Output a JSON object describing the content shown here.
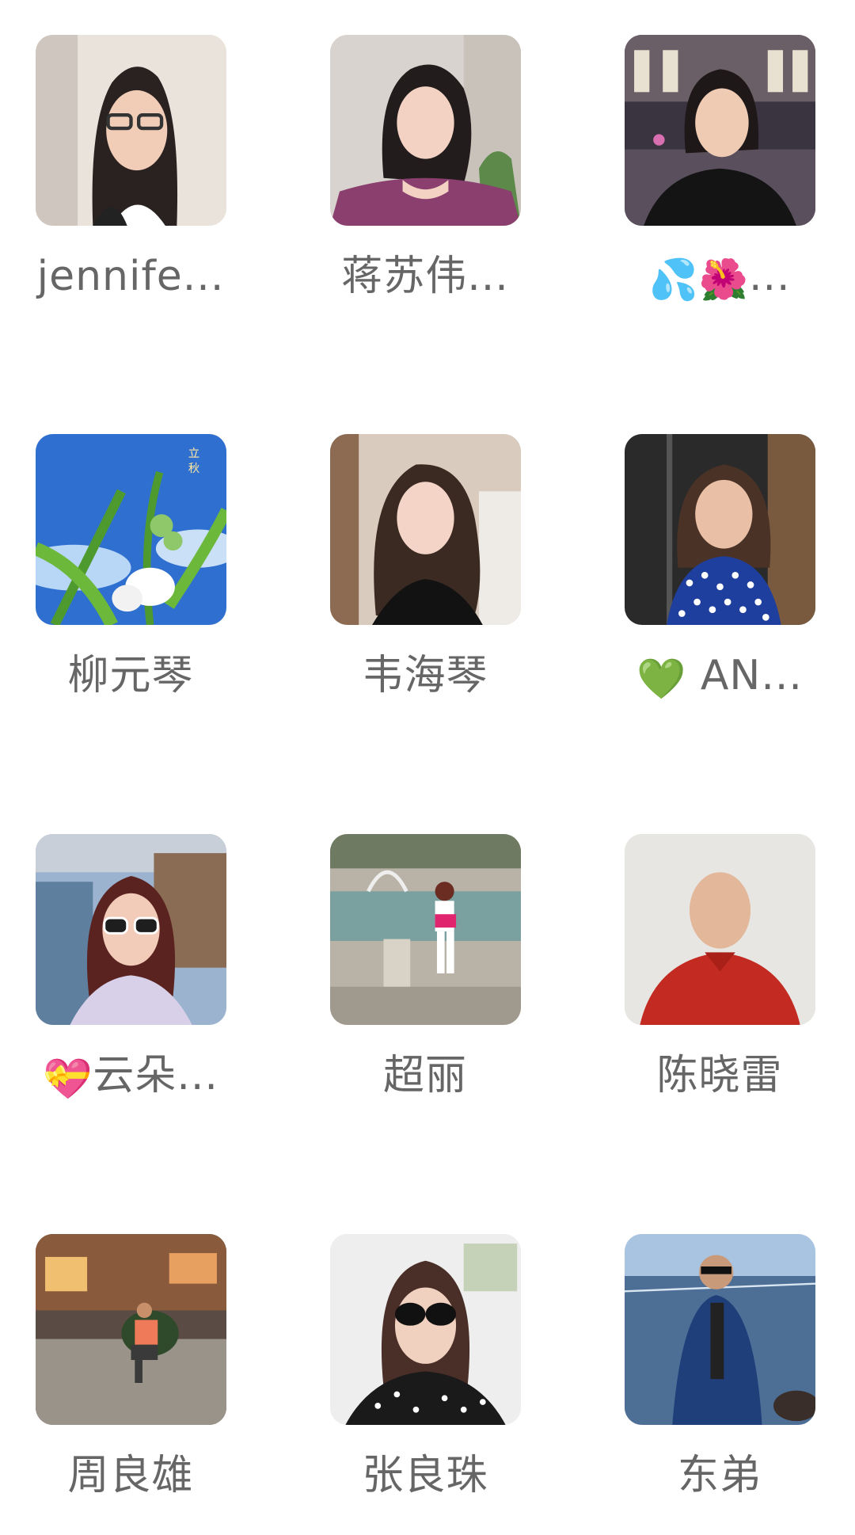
{
  "members": [
    {
      "name": "jennife...",
      "photo_icon": "woman-with-glasses-avatar"
    },
    {
      "name": "蒋苏伟...",
      "photo_icon": "woman-in-purple-avatar"
    },
    {
      "name_prefix": "💦🌺",
      "name": "...",
      "photo_icon": "woman-at-night-fountain-avatar"
    },
    {
      "name": "柳元琴",
      "photo_icon": "green-plant-blue-sky-avatar"
    },
    {
      "name": "韦海琴",
      "photo_icon": "woman-long-hair-avatar"
    },
    {
      "name_prefix": "💚",
      "name": "AN...",
      "photo_icon": "woman-polka-dot-avatar"
    },
    {
      "name_prefix": "💝",
      "name": "云朵...",
      "photo_icon": "woman-sunglasses-canal-avatar"
    },
    {
      "name": "超丽",
      "photo_icon": "woman-at-fountain-avatar"
    },
    {
      "name": "陈晓雷",
      "photo_icon": "bald-man-red-shirt-avatar"
    },
    {
      "name": "周良雄",
      "photo_icon": "man-sitting-street-night-avatar"
    },
    {
      "name": "张良珠",
      "photo_icon": "woman-big-sunglasses-avatar"
    },
    {
      "name": "东弟",
      "photo_icon": "man-by-sea-avatar"
    }
  ]
}
